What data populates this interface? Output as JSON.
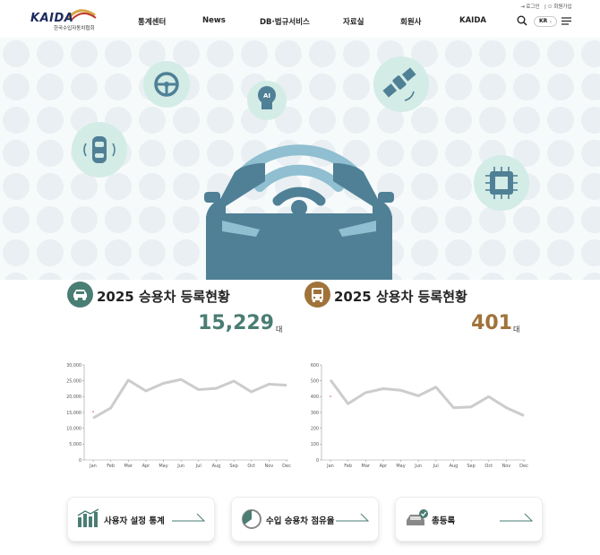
{
  "header": {
    "logo_text": "KAIDA",
    "logo_sub": "한국수입자동차협회",
    "nav": [
      "통계센터",
      "News",
      "DB·법규서비스",
      "자료실",
      "회원사",
      "KAIDA"
    ],
    "login": "로그인",
    "signup": "회원가입",
    "lang": "KR"
  },
  "stats": {
    "passenger": {
      "title": "2025 승용차 등록현황",
      "value": "15,229",
      "unit": "대",
      "color": "#4a7d73"
    },
    "commercial": {
      "title": "2025 상용차 등록현황",
      "value": "401",
      "unit": "대",
      "color": "#a0733a"
    }
  },
  "chart_data": [
    {
      "type": "line",
      "categories": [
        "Jan",
        "Feb",
        "Mar",
        "Apr",
        "May",
        "Jun",
        "Jul",
        "Aug",
        "Sep",
        "Oct",
        "Nov",
        "Dec"
      ],
      "series": [
        {
          "values": [
            13229,
            16400,
            25200,
            21800,
            24200,
            25400,
            22200,
            22600,
            24900,
            21500,
            23900,
            23600
          ]
        },
        {
          "values": [
            15229
          ]
        }
      ],
      "yticks": [
        "30,000",
        "25,000",
        "20,000",
        "15,000",
        "10,000",
        "5,000",
        "0"
      ],
      "ylim": [
        0,
        30000
      ]
    },
    {
      "type": "line",
      "categories": [
        "Jan",
        "Feb",
        "Mar",
        "Apr",
        "May",
        "Jun",
        "Jul",
        "Aug",
        "Sep",
        "Oct",
        "Nov",
        "Dec"
      ],
      "series": [
        {
          "values": [
            505,
            355,
            425,
            450,
            440,
            405,
            460,
            330,
            335,
            400,
            330,
            280
          ]
        },
        {
          "values": [
            401
          ]
        }
      ],
      "yticks": [
        "600",
        "500",
        "400",
        "300",
        "200",
        "100",
        "0"
      ],
      "ylim": [
        0,
        600
      ]
    }
  ],
  "cards": [
    {
      "label": "사용자 설정 통계",
      "icon": "bar-chart-icon"
    },
    {
      "label": "수입 승용차 점유율",
      "icon": "pie-chart-icon"
    },
    {
      "label": "총등록",
      "icon": "car-check-icon"
    }
  ],
  "colors": {
    "teal": "#4f8096",
    "mint": "#d7efe9",
    "line": "#cccccc"
  }
}
